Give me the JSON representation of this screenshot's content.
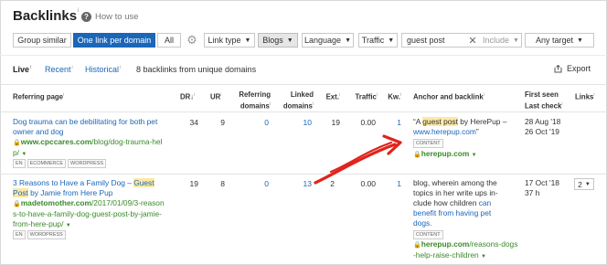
{
  "header": {
    "title": "Backlinks",
    "title_info": "i",
    "help_label": "How to use"
  },
  "filters": {
    "group_similar": "Group similar",
    "one_link_per_domain": "One link per domain",
    "all": "All",
    "link_type": "Link type",
    "blogs": "Blogs",
    "language": "Language",
    "traffic": "Traffic",
    "search_value": "guest post",
    "include": "Include",
    "any_target": "Any target"
  },
  "tabs": {
    "live": "Live",
    "recent": "Recent",
    "historical": "Historical",
    "info": "i"
  },
  "summary": "8 backlinks from unique domains",
  "export_label": "Export",
  "columns": {
    "referring_page": "Referring page",
    "dr": "DR",
    "dr_sort": "↓",
    "ur": "UR",
    "referring_domains_1": "Referring",
    "referring_domains_2": "domains",
    "linked_domains_1": "Linked",
    "linked_domains_2": "domains",
    "ext": "Ext.",
    "traffic": "Traffic",
    "kw": "Kw.",
    "anchor": "Anchor and backlink",
    "first_seen": "First seen",
    "last_check": "Last check",
    "links": "Links",
    "info": "i"
  },
  "rows": [
    {
      "title_line1": "Dog trauma can be debilitating for both pet",
      "title_line2": "owner and dog",
      "url_domain": "www.cpccares.com",
      "url_path1": "/blog/dog-trauma-hel",
      "url_path2": "p/",
      "tags": [
        "EN",
        "ECOMMERCE",
        "WORDPRESS"
      ],
      "dr": "34",
      "ur": "9",
      "ref_domains": "0",
      "linked_domains": "10",
      "ext": "19",
      "traffic": "0.00",
      "kw": "1",
      "anchor_open": "“A ",
      "anchor_hl": "guest post",
      "anchor_rest": " by HerePup –",
      "anchor_link": "www.herepup.com",
      "anchor_close": "”",
      "content_tag": "CONTENT",
      "backlink": "herepup.com",
      "first_seen": "28 Aug '18",
      "last_check": "26 Oct '19"
    },
    {
      "title_pre": "3 Reasons to Have a Family Dog – ",
      "title_hl1": "Guest",
      "title_hl2": "Post",
      "title_post": " by Jamie from Here Pup",
      "url_domain": "madetomother.com",
      "url_path1": "/2017/01/09/3-reason",
      "url_path2": "s-to-have-a-family-dog-guest-post-by-jamie-",
      "url_path3": "from-here-pup/",
      "tags": [
        "EN",
        "WORDPRESS"
      ],
      "dr": "19",
      "ur": "8",
      "ref_domains": "0",
      "linked_domains": "13",
      "ext": "2",
      "traffic": "0.00",
      "kw": "1",
      "anchor_t1": "blog, wherein among the",
      "anchor_t2": "topics in her write ups in-",
      "anchor_t3": "clude how children ",
      "anchor_link1": "can",
      "anchor_link2": "benefit from having pet",
      "anchor_link3": "dogs.",
      "content_tag": "CONTENT",
      "backlink1": "herepup.com",
      "backlink1_path": "/reasons-dogs",
      "backlink2": "-help-raise-children",
      "first_seen": "17 Oct '18",
      "last_check": "37 h",
      "links_count": "2"
    }
  ],
  "colors": {
    "accent": "#1a66b8",
    "link_green": "#3a8a2a",
    "highlight": "#fbe9a5",
    "annotation_arrow": "#e0231c"
  }
}
